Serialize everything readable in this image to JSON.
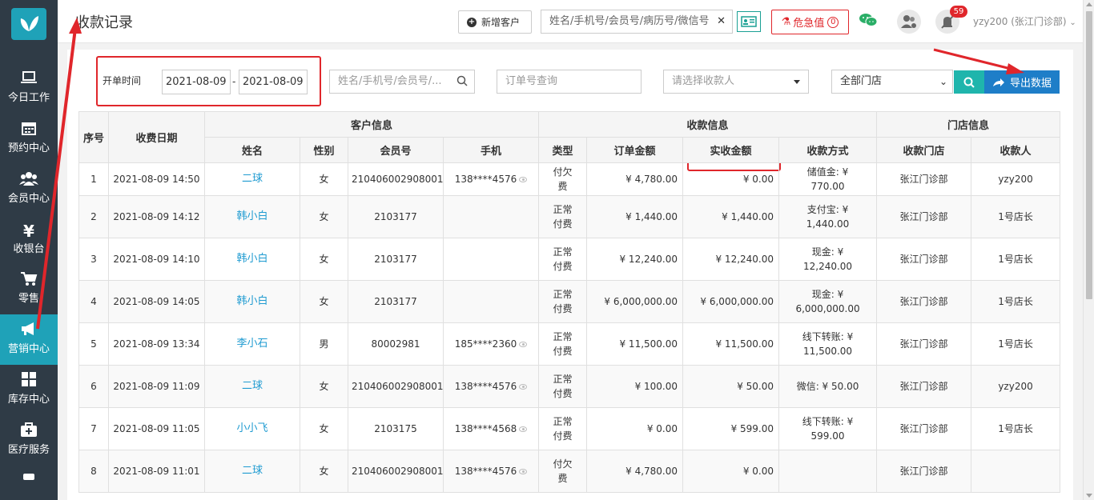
{
  "sidebar": {
    "items": [
      {
        "label": "今日工作",
        "icon": "laptop-icon"
      },
      {
        "label": "预约中心",
        "icon": "calendar-icon"
      },
      {
        "label": "会员中心",
        "icon": "users-icon"
      },
      {
        "label": "收银台",
        "icon": "yen-icon"
      },
      {
        "label": "零售",
        "icon": "cart-icon"
      },
      {
        "label": "营销中心",
        "icon": "megaphone-icon"
      },
      {
        "label": "库存中心",
        "icon": "grid-icon"
      },
      {
        "label": "医疗服务",
        "icon": "medkit-icon"
      }
    ],
    "active_index": 5
  },
  "header": {
    "title": "收款记录",
    "new_customer": "新增客户",
    "search_text": "姓名/手机号/会员号/病历号/微信号",
    "danger_label": "危急值",
    "danger_count": "0",
    "notification_count": "59",
    "user": "yzy200 (张江门诊部)"
  },
  "filters": {
    "date_label": "开单时间",
    "date_from": "2021-08-09",
    "date_sep": "-",
    "date_to": "2021-08-09",
    "customer_placeholder": "姓名/手机号/会员号/...",
    "order_placeholder": "订单号查询",
    "payee_placeholder": "请选择收款人",
    "store": "全部门店",
    "export_label": "导出数据"
  },
  "table": {
    "group_headers": {
      "seq": "序号",
      "date": "收费日期",
      "customer": "客户信息",
      "payment": "收款信息",
      "store": "门店信息"
    },
    "headers": {
      "name": "姓名",
      "gender": "性别",
      "member": "会员号",
      "phone": "手机",
      "type": "类型",
      "order_amount": "订单金额",
      "actual_amount": "实收金额",
      "method": "收款方式",
      "store": "收款门店",
      "payee": "收款人"
    },
    "rows": [
      {
        "seq": "1",
        "date": "2021-08-09 14:50",
        "name": "二球",
        "gender": "女",
        "member": "210406002908001",
        "phone": "138****4576",
        "type": "付欠费",
        "order": "¥ 4,780.00",
        "actual": "¥ 0.00",
        "method": "储值金: ¥ 770.00",
        "store": "张江门诊部",
        "payee": "yzy200"
      },
      {
        "seq": "2",
        "date": "2021-08-09 14:12",
        "name": "韩小白",
        "gender": "女",
        "member": "2103177",
        "phone": "",
        "type": "正常付费",
        "order": "¥ 1,440.00",
        "actual": "¥ 1,440.00",
        "method": "支付宝: ¥ 1,440.00",
        "store": "张江门诊部",
        "payee": "1号店长"
      },
      {
        "seq": "3",
        "date": "2021-08-09 14:10",
        "name": "韩小白",
        "gender": "女",
        "member": "2103177",
        "phone": "",
        "type": "正常付费",
        "order": "¥ 12,240.00",
        "actual": "¥ 12,240.00",
        "method": "现金: ¥ 12,240.00",
        "store": "张江门诊部",
        "payee": "1号店长"
      },
      {
        "seq": "4",
        "date": "2021-08-09 14:05",
        "name": "韩小白",
        "gender": "女",
        "member": "2103177",
        "phone": "",
        "type": "正常付费",
        "order": "¥ 6,000,000.00",
        "actual": "¥ 6,000,000.00",
        "method": "现金: ¥ 6,000,000.00",
        "store": "张江门诊部",
        "payee": "1号店长"
      },
      {
        "seq": "5",
        "date": "2021-08-09 13:34",
        "name": "李小石",
        "gender": "男",
        "member": "80002981",
        "phone": "185****2360",
        "type": "正常付费",
        "order": "¥ 11,500.00",
        "actual": "¥ 11,500.00",
        "method": "线下转账: ¥ 11,500.00",
        "store": "张江门诊部",
        "payee": "1号店长"
      },
      {
        "seq": "6",
        "date": "2021-08-09 11:09",
        "name": "二球",
        "gender": "女",
        "member": "210406002908001",
        "phone": "138****4576",
        "type": "正常付费",
        "order": "¥ 100.00",
        "actual": "¥ 50.00",
        "method": "微信: ¥ 50.00",
        "store": "张江门诊部",
        "payee": "yzy200"
      },
      {
        "seq": "7",
        "date": "2021-08-09 11:05",
        "name": "小小飞",
        "gender": "女",
        "member": "2103175",
        "phone": "138****4568",
        "type": "正常付费",
        "order": "¥ 0.00",
        "actual": "¥ 599.00",
        "method": "线下转账: ¥ 599.00",
        "store": "张江门诊部",
        "payee": "1号店长"
      },
      {
        "seq": "8",
        "date": "2021-08-09 11:01",
        "name": "二球",
        "gender": "女",
        "member": "210406002908001",
        "phone": "138****4576",
        "type": "付欠费",
        "order": "¥ 4,780.00",
        "actual": "¥ 0.00",
        "method": "",
        "store": "张江门诊部",
        "payee": ""
      }
    ]
  },
  "colors": {
    "sidebar_bg": "#2f3b46",
    "accent": "#1fa2b8",
    "link": "#1f9bd1",
    "danger": "#e0262b",
    "export": "#1e7ec8"
  }
}
